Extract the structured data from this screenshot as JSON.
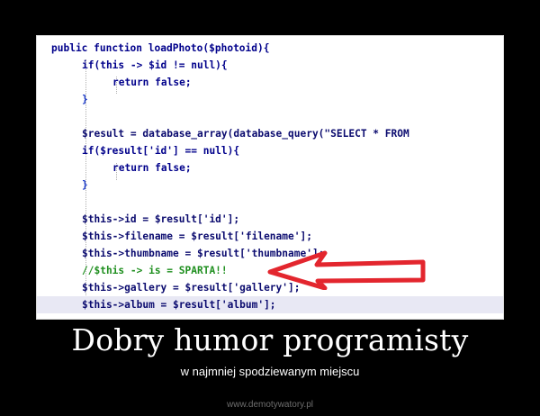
{
  "code_lines": [
    "public function loadPhoto($photoid){",
    "if(this -> $id != null){",
    "return false;",
    "}",
    "",
    "$result = database_array(database_query(\"SELECT * FROM",
    "if($result['id'] == null){",
    "return false;",
    "}",
    "",
    "$this->id = $result['id'];",
    "$this->filename = $result['filename'];",
    "$this->thumbname = $result['thumbname'];",
    "//$this -> is = SPARTA!!",
    "$this->gallery = $result['gallery'];",
    "$this->album = $result['album'];"
  ],
  "caption": {
    "title": "Dobry humor programisty",
    "subtitle": "w najmniej spodziewanym miejscu"
  },
  "watermark": "www.demotywatory.pl",
  "colors": {
    "background": "#000000",
    "arrow": "#e3262e",
    "comment": "#1f8f1f",
    "keyword": "#00008b"
  }
}
